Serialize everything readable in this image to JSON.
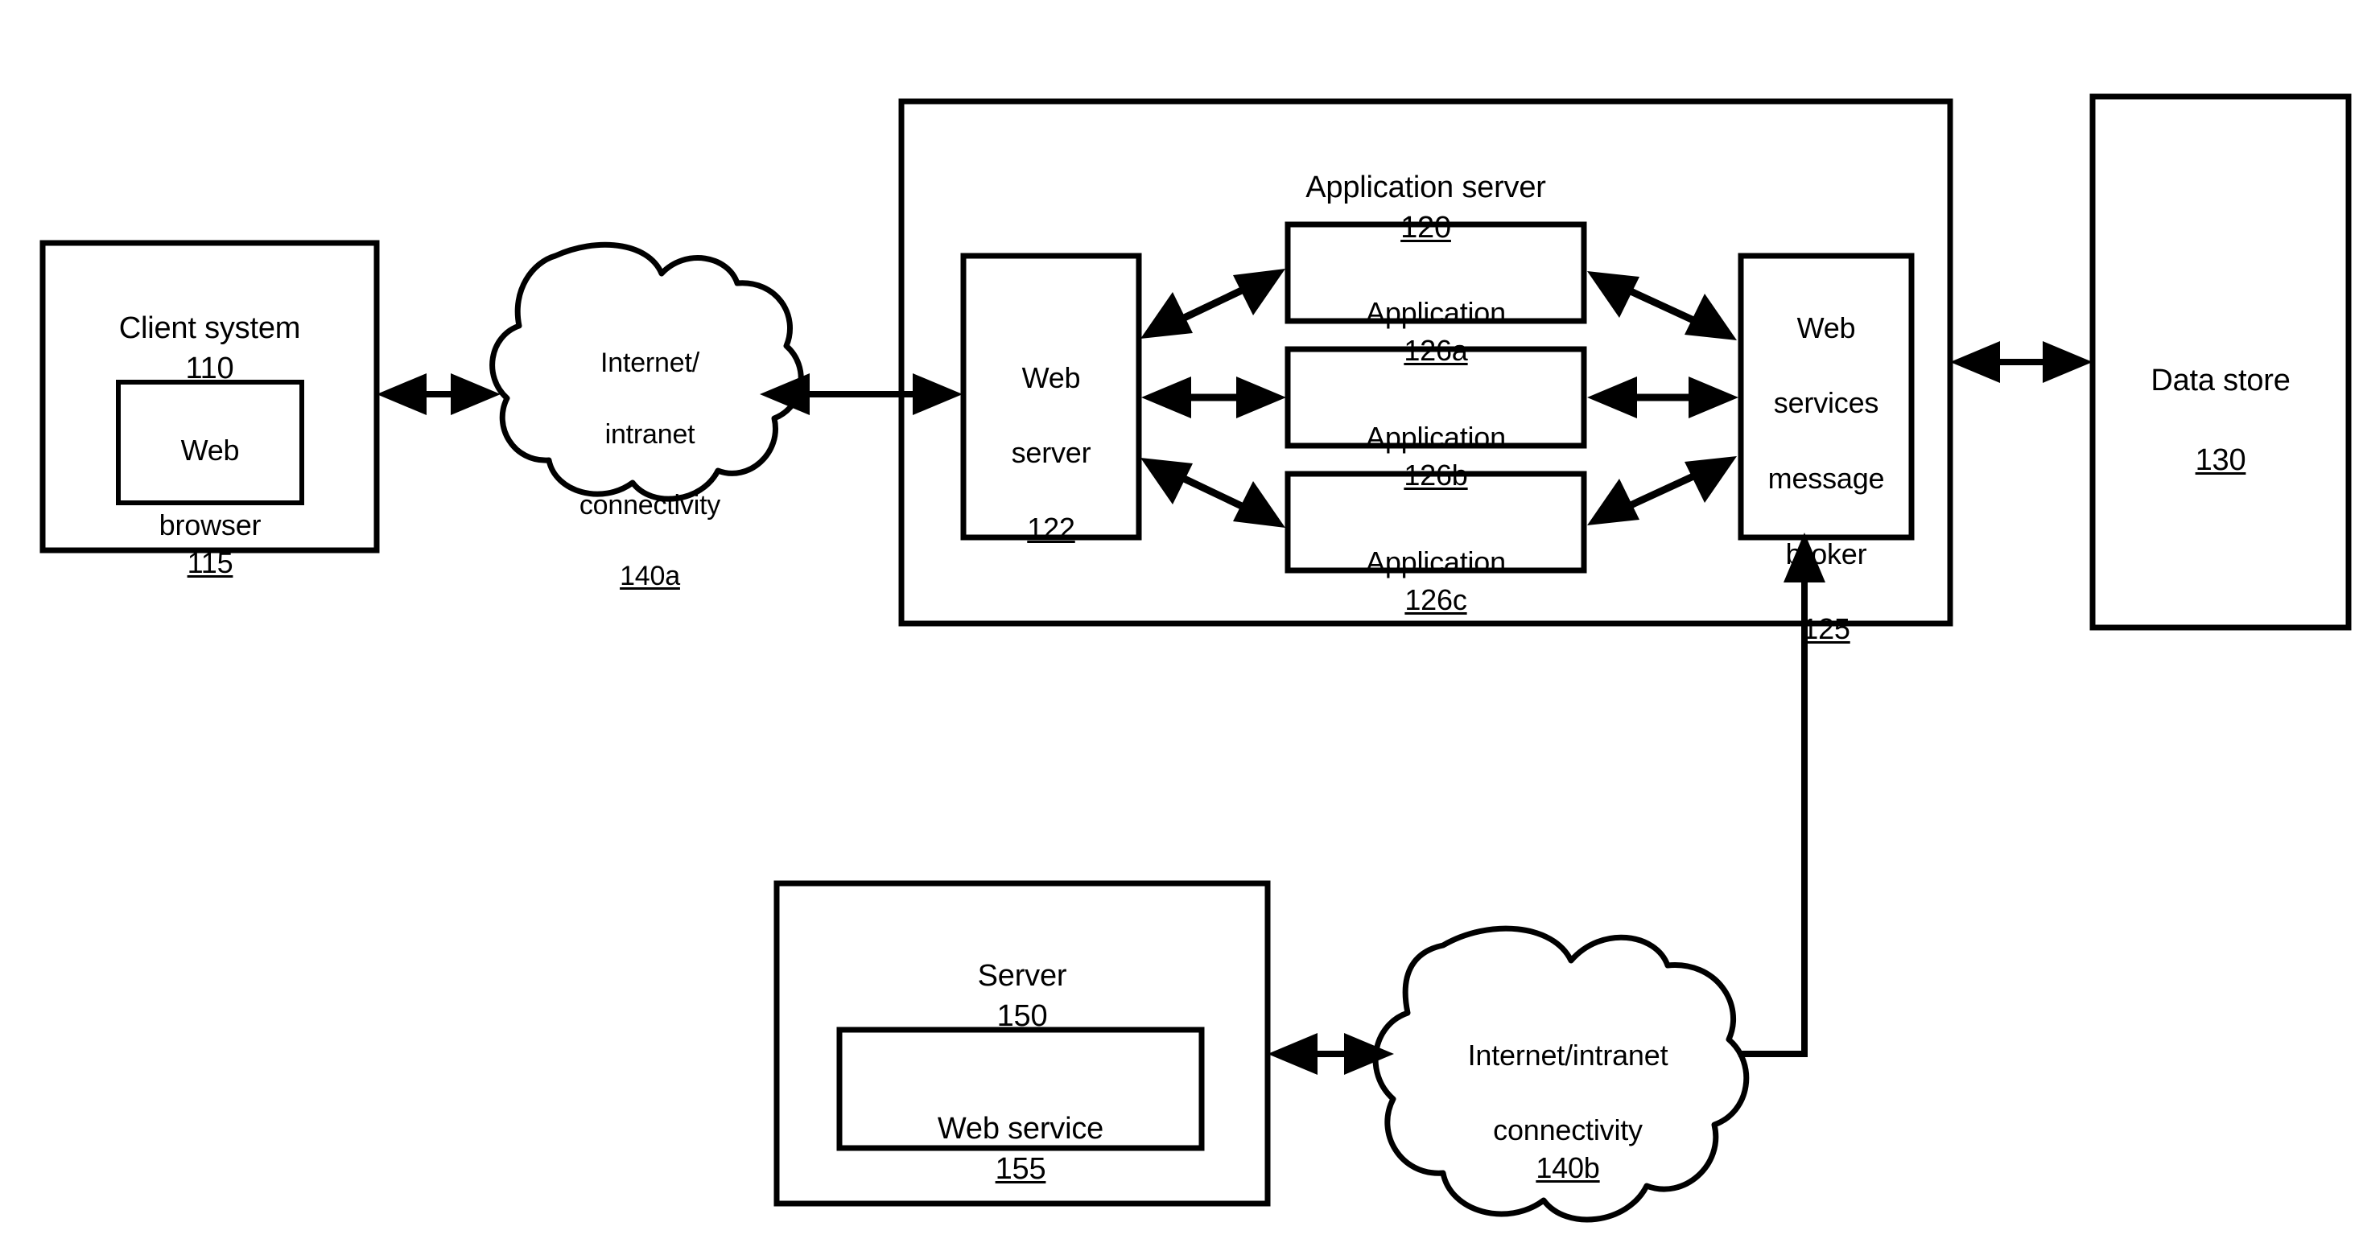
{
  "figure": {
    "type": "system-architecture-block-diagram",
    "style": "patent-line-drawing",
    "background_color": "#ffffff",
    "line_color": "#000000"
  },
  "nodes": {
    "client_system": {
      "label": "Client system",
      "ref": "110",
      "shape": "rectangle"
    },
    "web_browser": {
      "label_line1": "Web",
      "label_line2": "browser",
      "ref": "115",
      "shape": "rectangle"
    },
    "cloud_140a": {
      "line1": "Internet/",
      "line2": "intranet",
      "line3": "connectivity",
      "ref": "140a",
      "shape": "cloud"
    },
    "application_server": {
      "label": "Application server",
      "ref": "120",
      "shape": "rectangle"
    },
    "web_server": {
      "line1": "Web",
      "line2": "server",
      "ref": "122",
      "shape": "rectangle"
    },
    "application_a": {
      "label": "Application",
      "ref": "126a",
      "shape": "rectangle"
    },
    "application_b": {
      "label": "Application",
      "ref": "126b",
      "shape": "rectangle"
    },
    "application_c": {
      "label": "Application",
      "ref": "126c",
      "shape": "rectangle"
    },
    "message_broker": {
      "line1": "Web",
      "line2": "services",
      "line3": "message",
      "line4": "broker",
      "ref": "125",
      "shape": "rectangle"
    },
    "data_store": {
      "label": "Data store",
      "ref": "130",
      "shape": "rectangle"
    },
    "server_150": {
      "label": "Server",
      "ref": "150",
      "shape": "rectangle"
    },
    "web_service": {
      "label": "Web service",
      "ref": "155",
      "shape": "rectangle"
    },
    "cloud_140b": {
      "line1": "Internet/intranet",
      "line2": "connectivity",
      "ref": "140b",
      "shape": "cloud"
    }
  },
  "connections": [
    {
      "from": "client_system",
      "to": "cloud_140a",
      "arrow": "bidirectional",
      "orientation": "horizontal"
    },
    {
      "from": "cloud_140a",
      "to": "web_server",
      "arrow": "bidirectional",
      "orientation": "horizontal"
    },
    {
      "from": "web_server",
      "to": "application_a",
      "arrow": "bidirectional",
      "orientation": "diagonal"
    },
    {
      "from": "web_server",
      "to": "application_b",
      "arrow": "bidirectional",
      "orientation": "horizontal"
    },
    {
      "from": "web_server",
      "to": "application_c",
      "arrow": "bidirectional",
      "orientation": "diagonal"
    },
    {
      "from": "application_a",
      "to": "message_broker",
      "arrow": "bidirectional",
      "orientation": "diagonal"
    },
    {
      "from": "application_b",
      "to": "message_broker",
      "arrow": "bidirectional",
      "orientation": "horizontal"
    },
    {
      "from": "application_c",
      "to": "message_broker",
      "arrow": "bidirectional",
      "orientation": "diagonal"
    },
    {
      "from": "application_server",
      "to": "data_store",
      "arrow": "bidirectional",
      "orientation": "horizontal"
    },
    {
      "from": "server_150",
      "to": "cloud_140b",
      "arrow": "bidirectional",
      "orientation": "horizontal"
    },
    {
      "from": "cloud_140b",
      "to": "message_broker",
      "arrow": "single",
      "orientation": "elbow-up"
    }
  ]
}
